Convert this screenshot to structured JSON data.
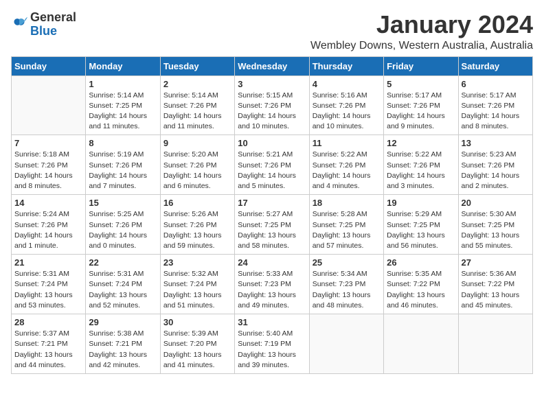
{
  "logo": {
    "general": "General",
    "blue": "Blue"
  },
  "title": "January 2024",
  "location": "Wembley Downs, Western Australia, Australia",
  "days_header": [
    "Sunday",
    "Monday",
    "Tuesday",
    "Wednesday",
    "Thursday",
    "Friday",
    "Saturday"
  ],
  "weeks": [
    [
      {
        "day": "",
        "empty": true
      },
      {
        "day": "1",
        "sunrise": "5:14 AM",
        "sunset": "7:25 PM",
        "daylight": "14 hours and 11 minutes."
      },
      {
        "day": "2",
        "sunrise": "5:14 AM",
        "sunset": "7:26 PM",
        "daylight": "14 hours and 11 minutes."
      },
      {
        "day": "3",
        "sunrise": "5:15 AM",
        "sunset": "7:26 PM",
        "daylight": "14 hours and 10 minutes."
      },
      {
        "day": "4",
        "sunrise": "5:16 AM",
        "sunset": "7:26 PM",
        "daylight": "14 hours and 10 minutes."
      },
      {
        "day": "5",
        "sunrise": "5:17 AM",
        "sunset": "7:26 PM",
        "daylight": "14 hours and 9 minutes."
      },
      {
        "day": "6",
        "sunrise": "5:17 AM",
        "sunset": "7:26 PM",
        "daylight": "14 hours and 8 minutes."
      }
    ],
    [
      {
        "day": "7",
        "sunrise": "5:18 AM",
        "sunset": "7:26 PM",
        "daylight": "14 hours and 8 minutes."
      },
      {
        "day": "8",
        "sunrise": "5:19 AM",
        "sunset": "7:26 PM",
        "daylight": "14 hours and 7 minutes."
      },
      {
        "day": "9",
        "sunrise": "5:20 AM",
        "sunset": "7:26 PM",
        "daylight": "14 hours and 6 minutes."
      },
      {
        "day": "10",
        "sunrise": "5:21 AM",
        "sunset": "7:26 PM",
        "daylight": "14 hours and 5 minutes."
      },
      {
        "day": "11",
        "sunrise": "5:22 AM",
        "sunset": "7:26 PM",
        "daylight": "14 hours and 4 minutes."
      },
      {
        "day": "12",
        "sunrise": "5:22 AM",
        "sunset": "7:26 PM",
        "daylight": "14 hours and 3 minutes."
      },
      {
        "day": "13",
        "sunrise": "5:23 AM",
        "sunset": "7:26 PM",
        "daylight": "14 hours and 2 minutes."
      }
    ],
    [
      {
        "day": "14",
        "sunrise": "5:24 AM",
        "sunset": "7:26 PM",
        "daylight": "14 hours and 1 minute."
      },
      {
        "day": "15",
        "sunrise": "5:25 AM",
        "sunset": "7:26 PM",
        "daylight": "14 hours and 0 minutes."
      },
      {
        "day": "16",
        "sunrise": "5:26 AM",
        "sunset": "7:26 PM",
        "daylight": "13 hours and 59 minutes."
      },
      {
        "day": "17",
        "sunrise": "5:27 AM",
        "sunset": "7:25 PM",
        "daylight": "13 hours and 58 minutes."
      },
      {
        "day": "18",
        "sunrise": "5:28 AM",
        "sunset": "7:25 PM",
        "daylight": "13 hours and 57 minutes."
      },
      {
        "day": "19",
        "sunrise": "5:29 AM",
        "sunset": "7:25 PM",
        "daylight": "13 hours and 56 minutes."
      },
      {
        "day": "20",
        "sunrise": "5:30 AM",
        "sunset": "7:25 PM",
        "daylight": "13 hours and 55 minutes."
      }
    ],
    [
      {
        "day": "21",
        "sunrise": "5:31 AM",
        "sunset": "7:24 PM",
        "daylight": "13 hours and 53 minutes."
      },
      {
        "day": "22",
        "sunrise": "5:31 AM",
        "sunset": "7:24 PM",
        "daylight": "13 hours and 52 minutes."
      },
      {
        "day": "23",
        "sunrise": "5:32 AM",
        "sunset": "7:24 PM",
        "daylight": "13 hours and 51 minutes."
      },
      {
        "day": "24",
        "sunrise": "5:33 AM",
        "sunset": "7:23 PM",
        "daylight": "13 hours and 49 minutes."
      },
      {
        "day": "25",
        "sunrise": "5:34 AM",
        "sunset": "7:23 PM",
        "daylight": "13 hours and 48 minutes."
      },
      {
        "day": "26",
        "sunrise": "5:35 AM",
        "sunset": "7:22 PM",
        "daylight": "13 hours and 46 minutes."
      },
      {
        "day": "27",
        "sunrise": "5:36 AM",
        "sunset": "7:22 PM",
        "daylight": "13 hours and 45 minutes."
      }
    ],
    [
      {
        "day": "28",
        "sunrise": "5:37 AM",
        "sunset": "7:21 PM",
        "daylight": "13 hours and 44 minutes."
      },
      {
        "day": "29",
        "sunrise": "5:38 AM",
        "sunset": "7:21 PM",
        "daylight": "13 hours and 42 minutes."
      },
      {
        "day": "30",
        "sunrise": "5:39 AM",
        "sunset": "7:20 PM",
        "daylight": "13 hours and 41 minutes."
      },
      {
        "day": "31",
        "sunrise": "5:40 AM",
        "sunset": "7:19 PM",
        "daylight": "13 hours and 39 minutes."
      },
      {
        "day": "",
        "empty": true
      },
      {
        "day": "",
        "empty": true
      },
      {
        "day": "",
        "empty": true
      }
    ]
  ]
}
